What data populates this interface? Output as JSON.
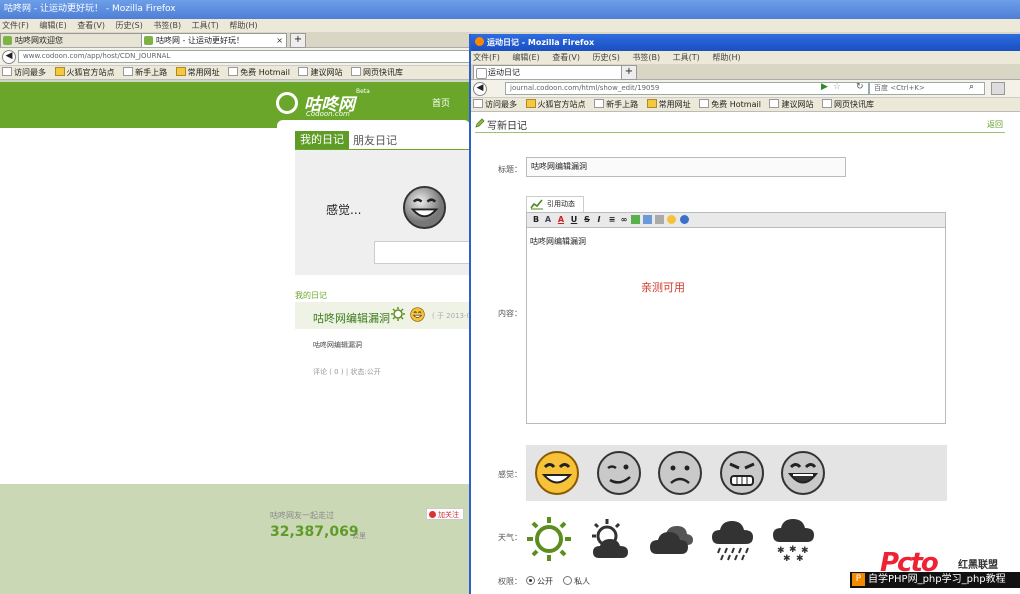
{
  "bg_window": {
    "title": "咕咚网 - 让运动更好玩！ - Mozilla Firefox",
    "menu": [
      "文件(F)",
      "编辑(E)",
      "查看(V)",
      "历史(S)",
      "书签(B)",
      "工具(T)",
      "帮助(H)"
    ],
    "tabs": [
      {
        "label": "咕咚网欢迎您"
      },
      {
        "label": "咕咚网 - 让运动更好玩！"
      }
    ],
    "newtab": "+",
    "url": "www.codoon.com/app/host/CDN_JOURNAL",
    "bookmarks": [
      "访问最多",
      "火狐官方站点",
      "新手上路",
      "常用网址",
      "免费 Hotmail",
      "建议网站",
      "网页快讯库"
    ],
    "logo_cn": "咕咚网",
    "logo_en": "Codoon.com",
    "logo_beta": "Beta",
    "nav_home": "首页",
    "tab_my": "我的日记",
    "tab_friend": "朋友日记",
    "mood_label": "感觉...",
    "my_diary_heading": "我的日记",
    "entry_title": "咕咚网编辑漏洞",
    "entry_date": "( 于 2013-0",
    "entry_body": "咕咚网编辑漏洞",
    "entry_meta": "评论 ( 0 )  |  状态:公开",
    "footer_text": "咕咚网友一起走过",
    "footer_count": "32,387,069",
    "footer_unit": "公里",
    "follow": "加关注"
  },
  "fg_window": {
    "title": "运动日记 - Mozilla Firefox",
    "menu": [
      "文件(F)",
      "编辑(E)",
      "查看(V)",
      "历史(S)",
      "书签(B)",
      "工具(T)",
      "帮助(H)"
    ],
    "tab": "运动日记",
    "newtab": "+",
    "url": "journal.codoon.com/html/show_edit/19059",
    "search_placeholder": "百度 <Ctrl+K>",
    "bookmarks": [
      "访问最多",
      "火狐官方站点",
      "新手上路",
      "常用网址",
      "免费 Hotmail",
      "建议网站",
      "网页快讯库"
    ],
    "page_title": "写新日记",
    "back_link": "返回",
    "label_title": "标题：",
    "title_value": "咕咚网编辑漏洞",
    "quote_tab": "引用动态",
    "label_content": "内容：",
    "toolbar": [
      "B",
      "A",
      "A",
      "U",
      "S",
      "I"
    ],
    "editor_text": "咕咚网编辑漏洞",
    "editor_red_text": "亲测可用",
    "label_mood": "感觉：",
    "label_weather": "天气：",
    "label_privacy": "权限：",
    "privacy_public": "公开",
    "privacy_private": "私人"
  },
  "watermark": {
    "big": "Pcto",
    "side": "红黑联盟",
    "bar": "自学PHP网_php学习_php教程",
    "p": "P"
  },
  "colors": {
    "brand_green": "#6aa62a",
    "accent_red": "#d03a2a",
    "titlebar_blue": "#2e6ce0"
  }
}
